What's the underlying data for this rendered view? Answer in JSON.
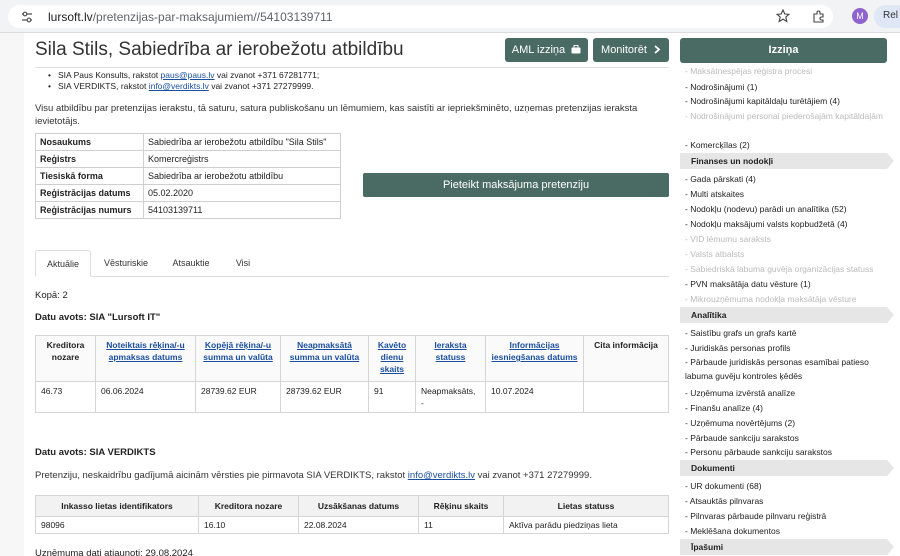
{
  "browser": {
    "url_host": "lursoft.lv",
    "url_path": "/pretenzijas-par-maksajumiem//54103139711",
    "profile_initial": "M",
    "reload_label": "Rel"
  },
  "header": {
    "company_title": "Sila Stils, Sabiedrība ar ierobežotu atbildību",
    "aml_button": "AML izziņa",
    "monitor_button": "Monitorēt"
  },
  "contacts": [
    {
      "prefix": "SIA Paus Konsults, rakstot ",
      "email": "paus@paus.lv",
      "suffix": " vai zvanot +371 67281771;"
    },
    {
      "prefix": "SIA VERDIKTS, rakstot ",
      "email": "info@verdikts.lv",
      "suffix": " vai zvanot +371 27279999."
    }
  ],
  "notice": "Visu atbildību par pretenzijas ierakstu, tā saturu, satura publiskošanu un lēmumiem, kas saistīti ar iepriekšminēto, uzņemas pretenzijas ieraksta ievietotājs.",
  "info": [
    {
      "key": "Nosaukums",
      "value": "Sabiedrība ar ierobežotu atbildību \"Sila Stils\""
    },
    {
      "key": "Reģistrs",
      "value": "Komercreģistrs"
    },
    {
      "key": "Tiesiskā forma",
      "value": "Sabiedrība ar ierobežotu atbildību"
    },
    {
      "key": "Reģistrācijas datums",
      "value": "05.02.2020"
    },
    {
      "key": "Reģistrācijas numurs",
      "value": "54103139711"
    }
  ],
  "claim_button": "Pieteikt maksājuma pretenziju",
  "tabs": [
    "Aktuālie",
    "Vēsturiskie",
    "Atsauktie",
    "Visi"
  ],
  "count_label": "Kopā: 2",
  "source1_title": "Datu avots: SIA \"Lursoft IT\"",
  "claims_table": {
    "headers": [
      {
        "label": "Kreditora nozare",
        "linked": false
      },
      {
        "label": "Noteiktais rēķina/-u apmaksas datums",
        "linked": true
      },
      {
        "label": "Kopējā rēķina/-u summa un valūta",
        "linked": true
      },
      {
        "label": "Neapmaksātā summa un valūta",
        "linked": true
      },
      {
        "label": "Kavēto dienu skaits",
        "linked": true
      },
      {
        "label": "Ieraksta statuss",
        "linked": true
      },
      {
        "label": "Informācijas iesniegšanas datums",
        "linked": true
      },
      {
        "label": "Cita informācija",
        "linked": false
      }
    ],
    "rows": [
      [
        "46.73",
        "06.06.2024",
        "28739.62 EUR",
        "28739.62 EUR",
        "91",
        "Neapmaksāts, -",
        "10.07.2024",
        ""
      ]
    ]
  },
  "source2_title": "Datu avots: SIA VERDIKTS",
  "verdikts_note": {
    "prefix": "Pretenziju, neskaidrību gadījumā aicinām vērsties pie pirmavota SIA VERDIKTS, rakstot ",
    "email": "info@verdikts.lv",
    "suffix": " vai zvanot +371 27279999."
  },
  "debt_table": {
    "headers": [
      "Inkasso lietas identifikators",
      "Kreditora nozare",
      "Uzsākšanas datums",
      "Rēķinu skaits",
      "Lietas statuss"
    ],
    "rows": [
      [
        "98096",
        "16.10",
        "22.08.2024",
        "11",
        "Aktīva parādu piedziņas lieta"
      ]
    ]
  },
  "updated_label": "Uzņēmuma dati atjaunoti: 29.08.2024",
  "sidebar": {
    "button": "Izziņa",
    "items_top": [
      {
        "label": "- Maksātnespējas reģistra procesi",
        "dim": true
      },
      {
        "label": "- Nodrošinājumi (1)",
        "dim": false
      },
      {
        "label": "- Nodrošinājumi kapitāldaļu turētājiem (4)",
        "dim": false
      },
      {
        "label": "- Nodrošinājumi personai piederošajām kapitāldaļām",
        "dim": true
      },
      {
        "label": "- Komercķīlas (2)",
        "dim": false
      }
    ],
    "section_finance": "Finanses un nodokļi",
    "items_finance": [
      {
        "label": "- Gada pārskati (4)",
        "dim": false
      },
      {
        "label": "- Multi atskaites",
        "dim": false
      },
      {
        "label": "- Nodokļu (nodevu) parādi un analītika (52)",
        "dim": false
      },
      {
        "label": "- Nodokļu maksājumi valsts kopbudžetā (4)",
        "dim": false
      },
      {
        "label": "- VID lēmumu saraksts",
        "dim": true
      },
      {
        "label": "- Valsts atbalsts",
        "dim": true
      },
      {
        "label": "- Sabiedriskā labuma guvēja organizācijas statuss",
        "dim": true
      },
      {
        "label": "- PVN maksātāja datu vēsture (1)",
        "dim": false
      },
      {
        "label": "- Mikrouzņēmuma nodokļa maksātāja vēsture",
        "dim": true
      }
    ],
    "section_analytics": "Analītika",
    "items_analytics": [
      {
        "label": "- Saistību grafs un grafs kartē",
        "dim": false
      },
      {
        "label": "- Juridiskās personas profils",
        "dim": false
      },
      {
        "label": "- Pārbaude juridiskās personas esamībai patieso labuma guvēju kontroles ķēdēs",
        "dim": false
      },
      {
        "label": "- Uzņēmuma izvērstā analīze",
        "dim": false
      },
      {
        "label": "- Finanšu analīze (4)",
        "dim": false
      },
      {
        "label": "- Uzņēmuma novērtējums (2)",
        "dim": false
      },
      {
        "label": "- Pārbaude sankciju sarakstos",
        "dim": false
      },
      {
        "label": "- Personu pārbaude sankciju sarakstos",
        "dim": false
      }
    ],
    "section_documents": "Dokumenti",
    "items_documents": [
      {
        "label": "- UR dokumenti (68)",
        "dim": false
      },
      {
        "label": "- Atsauktās pilnvaras",
        "dim": false
      },
      {
        "label": "- Pilnvaras pārbaude pilnvaru reģistrā",
        "dim": false
      },
      {
        "label": "- Meklēšana dokumentos",
        "dim": false
      }
    ],
    "section_property": "Īpašumi"
  }
}
